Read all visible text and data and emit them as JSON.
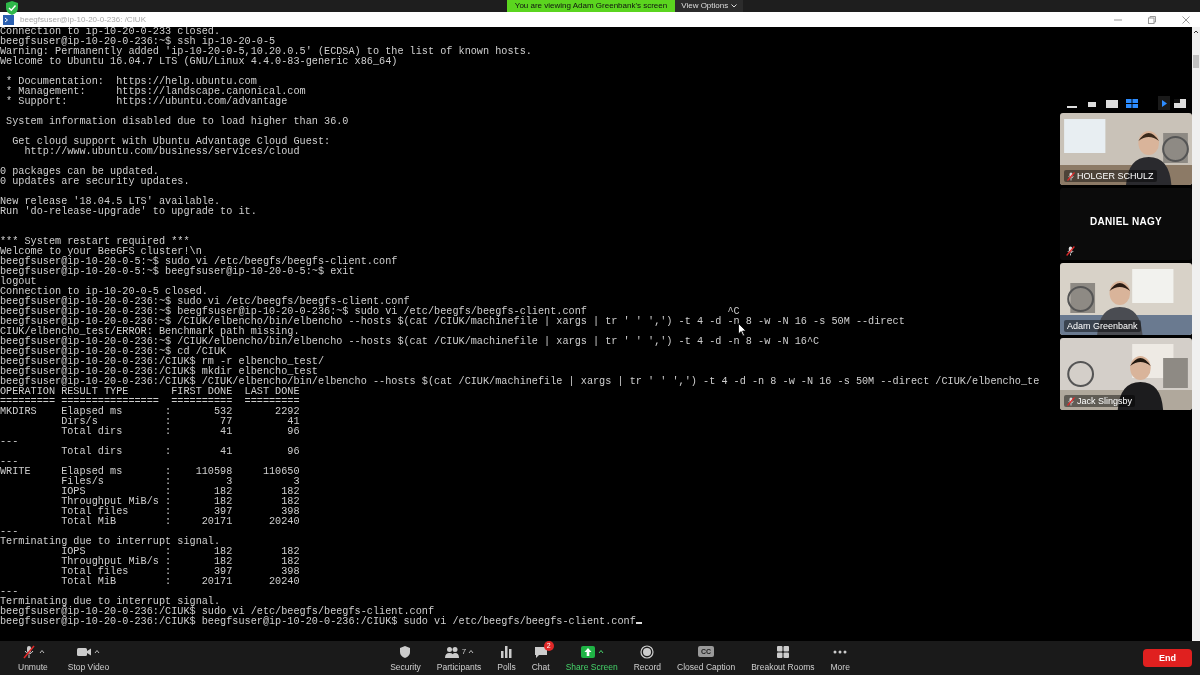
{
  "share_banner": {
    "text": "You are viewing Adam Greenbank's screen",
    "view_options": "View Options"
  },
  "window": {
    "title": "beegfsuser@ip-10-20-0-236: /CIUK"
  },
  "terminal": {
    "cursor": true,
    "lines": [
      {
        "text": "Connection to ip-10-20-0-233 closed."
      },
      {
        "text": "beegfsuser@ip-10-20-0-236:~$ ssh ip-10-20-0-5"
      },
      {
        "text": "Warning: Permanently added 'ip-10-20-0-5,10.20.0.5' (ECDSA) to the list of known hosts."
      },
      {
        "text": "Welcome to Ubuntu 16.04.7 LTS (GNU/Linux 4.4.0-83-generic x86_64)"
      },
      {
        "kind": "blank"
      },
      {
        "text": " * Documentation:  https://help.ubuntu.com"
      },
      {
        "text": " * Management:     https://landscape.canonical.com"
      },
      {
        "text": " * Support:        https://ubuntu.com/advantage"
      },
      {
        "kind": "blank"
      },
      {
        "text": " System information disabled due to load higher than 36.0"
      },
      {
        "kind": "blank"
      },
      {
        "text": "  Get cloud support with Ubuntu Advantage Cloud Guest:"
      },
      {
        "text": "    http://www.ubuntu.com/business/services/cloud"
      },
      {
        "kind": "blank"
      },
      {
        "text": "0 packages can be updated."
      },
      {
        "text": "0 updates are security updates."
      },
      {
        "kind": "blank"
      },
      {
        "text": "New release '18.04.5 LTS' available."
      },
      {
        "text": "Run 'do-release-upgrade' to upgrade to it."
      },
      {
        "kind": "blank"
      },
      {
        "kind": "blank"
      },
      {
        "text": "*** System restart required ***"
      },
      {
        "text": "Welcome to your BeeGFS cluster!\\n"
      },
      {
        "text": "beegfsuser@ip-10-20-0-5:~$ sudo vi /etc/beegfs/beegfs-client.conf"
      },
      {
        "text": "beegfsuser@ip-10-20-0-5:~$ beegfsuser@ip-10-20-0-5:~$ exit"
      },
      {
        "text": "logout"
      },
      {
        "text": "Connection to ip-10-20-0-5 closed."
      },
      {
        "text": "beegfsuser@ip-10-20-0-236:~$ sudo vi /etc/beegfs/beegfs-client.conf"
      },
      {
        "text": "beegfsuser@ip-10-20-0-236:~$ beegfsuser@ip-10-20-0-236:~$ sudo vi /etc/beegfs/beegfs-client.conf                       ^C"
      },
      {
        "text": "beegfsuser@ip-10-20-0-236:~$ /CIUK/elbencho/bin/elbencho --hosts $(cat /CIUK/machinefile | xargs | tr ' ' ',') -t 4 -d -n 8 -w -N 16 -s 50M --direct"
      },
      {
        "text": "CIUK/elbencho_test/ERROR: Benchmark path missing."
      },
      {
        "text": "beegfsuser@ip-10-20-0-236:~$ /CIUK/elbencho/bin/elbencho --hosts $(cat /CIUK/machinefile | xargs | tr ' ' ',') -t 4 -d -n 8 -w -N 16^C"
      },
      {
        "text": "beegfsuser@ip-10-20-0-236:~$ cd /CIUK"
      },
      {
        "text": "beegfsuser@ip-10-20-0-236:/CIUK$ rm -r elbencho_test/"
      },
      {
        "text": "beegfsuser@ip-10-20-0-236:/CIUK$ mkdir elbencho_test"
      },
      {
        "text": "beegfsuser@ip-10-20-0-236:/CIUK$ /CIUK/elbencho/bin/elbencho --hosts $(cat /CIUK/machinefile | xargs | tr ' ' ',') -t 4 -d -n 8 -w -N 16 -s 50M --direct /CIUK/elbencho_te"
      },
      {
        "text": "OPERATION RESULT TYPE       FIRST DONE  LAST DONE"
      },
      {
        "text": "========= ================  ==========  ========="
      },
      {
        "text": "MKDIRS    Elapsed ms       :       532       2292"
      },
      {
        "text": "          Dirs/s           :        77         41"
      },
      {
        "text": "          Total dirs       :        41         96"
      },
      {
        "text": "---"
      },
      {
        "text": "          Total dirs       :        41         96"
      },
      {
        "text": "---"
      },
      {
        "text": "WRITE     Elapsed ms       :    110598     110650"
      },
      {
        "text": "          Files/s          :         3          3"
      },
      {
        "text": "          IOPS             :       182        182"
      },
      {
        "text": "          Throughput MiB/s :       182        182"
      },
      {
        "text": "          Total files      :       397        398"
      },
      {
        "text": "          Total MiB        :     20171      20240"
      },
      {
        "text": "---"
      },
      {
        "text": "Terminating due to interrupt signal."
      },
      {
        "text": "          IOPS             :       182        182"
      },
      {
        "text": "          Throughput MiB/s :       182        182"
      },
      {
        "text": "          Total files      :       397        398"
      },
      {
        "text": "          Total MiB        :     20171      20240"
      },
      {
        "text": "---"
      },
      {
        "text": "Terminating due to interrupt signal."
      },
      {
        "text": "beegfsuser@ip-10-20-0-236:/CIUK$ sudo vi /etc/beegfs/beegfs-client.conf"
      },
      {
        "text": "beegfsuser@ip-10-20-0-236:/CIUK$ beegfsuser@ip-10-20-0-236:/CIUK$ sudo vi /etc/beegfs/beegfs-client.conf"
      }
    ]
  },
  "video_panel": {
    "view_modes": [
      {
        "kind": "minimize",
        "selected": false
      },
      {
        "kind": "strip",
        "selected": false
      },
      {
        "kind": "speaker",
        "selected": false
      },
      {
        "kind": "gallery",
        "selected": true
      }
    ],
    "participants": [
      {
        "name": "HOLGER SCHULZ",
        "video": true,
        "muted": true
      },
      {
        "name": "DANIEL NAGY",
        "video": false,
        "muted": true
      },
      {
        "name": "Adam Greenbank",
        "video": true,
        "muted": false
      },
      {
        "name": "Jack Slingsby",
        "video": true,
        "muted": true
      }
    ]
  },
  "toolbar": {
    "left": [
      {
        "label": "Unmute",
        "kind": "mic-muted",
        "caret": true
      },
      {
        "label": "Stop Video",
        "kind": "camera",
        "caret": true
      }
    ],
    "center": [
      {
        "label": "Security",
        "kind": "shield"
      },
      {
        "label": "Participants",
        "kind": "people",
        "count": "7",
        "caret": true
      },
      {
        "label": "Polls",
        "kind": "bars"
      },
      {
        "label": "Chat",
        "kind": "chat",
        "badge": "2"
      },
      {
        "label": "Share Screen",
        "kind": "share",
        "caret": true
      },
      {
        "label": "Record",
        "kind": "record"
      },
      {
        "label": "Closed Caption",
        "kind": "cc",
        "icon_text": "CC"
      },
      {
        "label": "Breakout Rooms",
        "kind": "rooms"
      },
      {
        "label": "More",
        "kind": "more"
      }
    ],
    "end": "End"
  }
}
